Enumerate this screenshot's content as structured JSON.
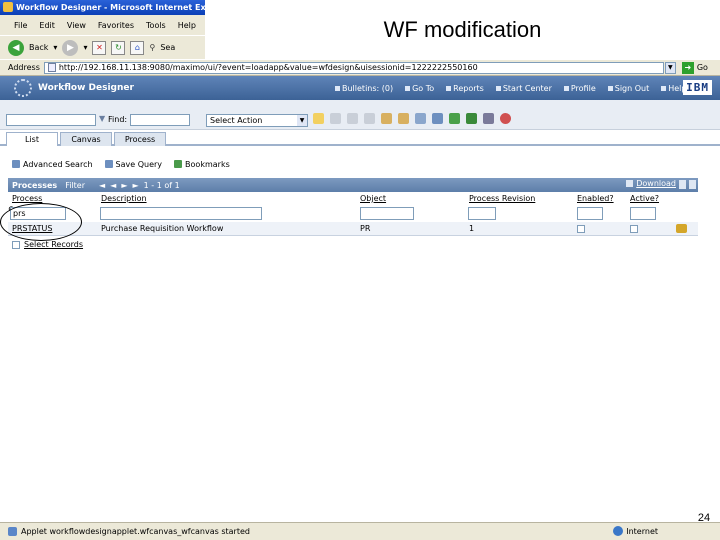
{
  "slide": {
    "title": "WF modification",
    "page_number": "24"
  },
  "browser": {
    "window_title": "Workflow Designer - Microsoft Internet Explorer",
    "menu": [
      "File",
      "Edit",
      "View",
      "Favorites",
      "Tools",
      "Help"
    ],
    "toolbar": {
      "back_label": "Back",
      "search_label": "Sea"
    },
    "address_label": "Address",
    "address_value": "http://192.168.11.138:9080/maximo/ui/?event=loadapp&value=wfdesign&uisessionid=1222222550160",
    "go_label": "Go",
    "status_text": "Applet workflowdesignapplet.wfcanvas_wfcanvas started",
    "status_zone": "Internet"
  },
  "app": {
    "title": "Workflow Designer",
    "nav": [
      "Bulletins: (0)",
      "Go To",
      "Reports",
      "Start Center",
      "Profile",
      "Sign Out",
      "Help"
    ],
    "brand": "IBM",
    "find_label": "Find:",
    "find_value": "",
    "action_select": "Select Action",
    "tabs": [
      "List",
      "Canvas",
      "Process"
    ],
    "active_tab": "List",
    "query_bar": [
      "Advanced Search",
      "Save Query",
      "Bookmarks"
    ]
  },
  "table": {
    "title": "Processes",
    "filter_label": "Filter",
    "pager": [
      "◄",
      "◄",
      "►",
      "►",
      "1 - 1 of 1"
    ],
    "download_label": "Download",
    "columns": [
      "Process",
      "Description",
      "Object",
      "Process Revision",
      "Enabled?",
      "Active?"
    ],
    "filters": {
      "process": "prs",
      "description": "",
      "object": "",
      "revision": ""
    },
    "rows": [
      {
        "process": "PRSTATUS",
        "description": "Purchase Requisition Workflow",
        "object": "PR",
        "revision": "1"
      }
    ],
    "select_records_label": "Select Records"
  }
}
